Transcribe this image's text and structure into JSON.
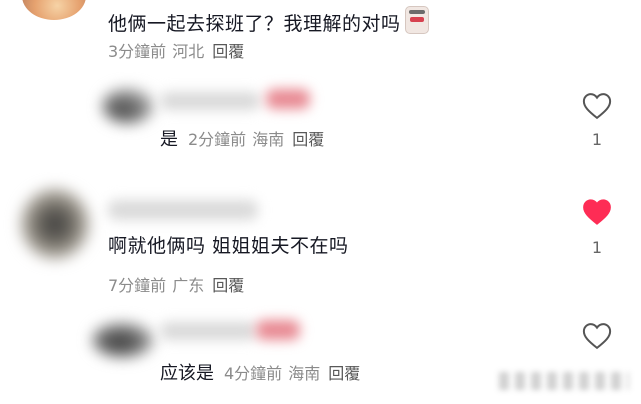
{
  "comment1": {
    "text": "他俩一起去探班了？我理解的对吗",
    "time": "3分鐘前",
    "location": "河北",
    "reply_label": "回覆"
  },
  "reply1": {
    "text": "是",
    "time": "2分鐘前",
    "location": "海南",
    "reply_label": "回覆",
    "likes": "1",
    "liked": false
  },
  "comment2": {
    "text": "啊就他俩吗 姐姐姐夫不在吗",
    "time": "7分鐘前",
    "location": "广东",
    "reply_label": "回覆",
    "likes": "1",
    "liked": true
  },
  "reply2": {
    "text": "应该是",
    "time": "4分鐘前",
    "location": "海南",
    "reply_label": "回覆"
  },
  "colors": {
    "liked_heart": "#fe2c55",
    "meta_gray": "#8b8b8b",
    "text_dark": "#161823"
  },
  "icons": {
    "like": "heart-outline-icon",
    "liked": "heart-filled-icon"
  }
}
